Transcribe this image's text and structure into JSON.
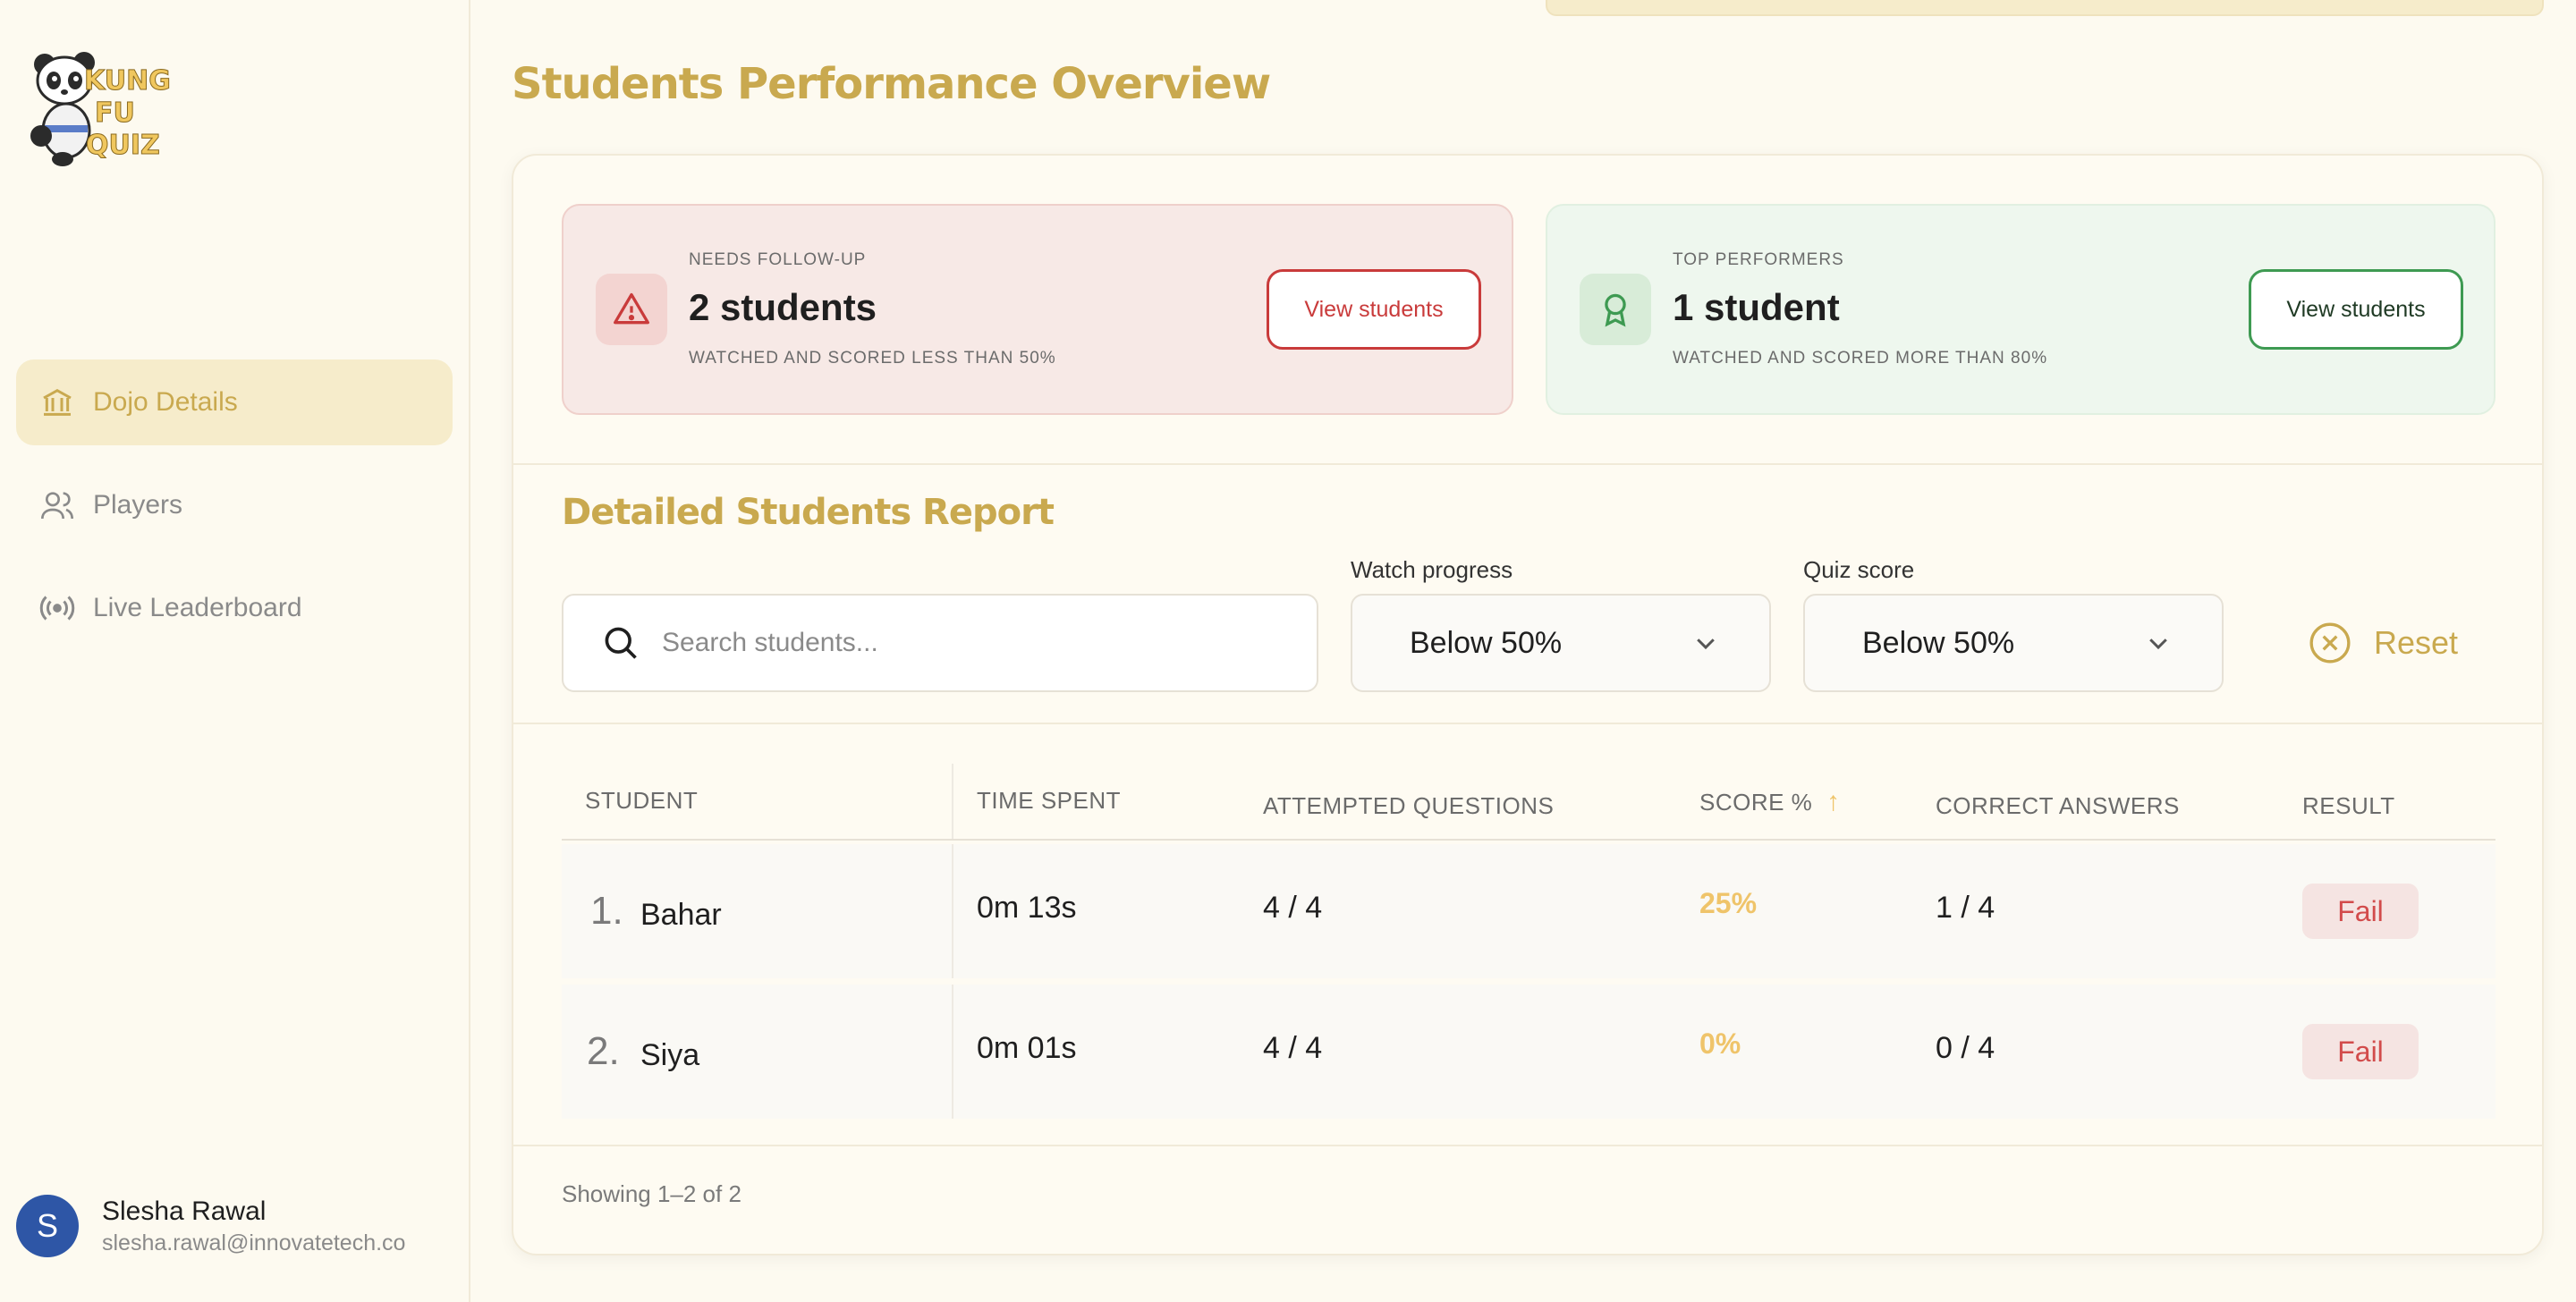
{
  "sidebar": {
    "logo_text": "KUNG FU QUIZ",
    "nav": [
      {
        "label": "Dojo Details",
        "icon": "dojo-icon",
        "active": true
      },
      {
        "label": "Players",
        "icon": "users-icon",
        "active": false
      },
      {
        "label": "Live Leaderboard",
        "icon": "broadcast-icon",
        "active": false
      }
    ],
    "user": {
      "initial": "S",
      "name": "Slesha Rawal",
      "email": "slesha.rawal@innovatetech.co"
    }
  },
  "main": {
    "title": "Students Performance Overview",
    "summary": {
      "follow_up": {
        "label": "NEEDS FOLLOW-UP",
        "value": "2 students",
        "description": "WATCHED AND SCORED LESS THAN 50%",
        "button": "View students"
      },
      "top": {
        "label": "TOP PERFORMERS",
        "value": "1 student",
        "description": "WATCHED AND SCORED MORE THAN 80%",
        "button": "View students"
      }
    },
    "report": {
      "title": "Detailed Students Report",
      "search_placeholder": "Search students...",
      "filters": {
        "watch_label": "Watch progress",
        "watch_value": "Below 50%",
        "quiz_label": "Quiz score",
        "quiz_value": "Below 50%",
        "reset_label": "Reset"
      },
      "columns": {
        "student": "STUDENT",
        "time": "TIME SPENT",
        "attempted": "ATTEMPTED QUESTIONS",
        "score": "SCORE %",
        "score_sort": "↑",
        "correct": "CORRECT ANSWERS",
        "result": "RESULT"
      },
      "rows": [
        {
          "index": "1.",
          "name": "Bahar",
          "time": "0m 13s",
          "attempted": "4 / 4",
          "score": "25%",
          "correct": "1 / 4",
          "result": "Fail"
        },
        {
          "index": "2.",
          "name": "Siya",
          "time": "0m 01s",
          "attempted": "4 / 4",
          "score": "0%",
          "correct": "0 / 4",
          "result": "Fail"
        }
      ],
      "footer": "Showing 1–2 of 2"
    }
  },
  "colors": {
    "accent": "#c9a94f",
    "danger": "#c93b3b",
    "success": "#3e9a52",
    "score": "#efc46a"
  }
}
